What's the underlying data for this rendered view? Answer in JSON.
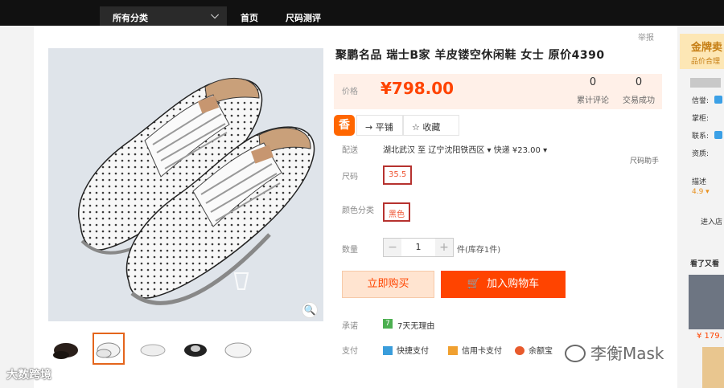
{
  "topnav": {
    "category": "所有分类",
    "links": [
      "首页",
      "尺码测评"
    ]
  },
  "product": {
    "title": "聚鹏名品 瑞士B家 羊皮镂空休闲鞋 女士 原价4390",
    "report": "举报",
    "price_label": "价格",
    "price": "¥798.00",
    "reviews_count": "0",
    "reviews_label": "累计评论",
    "sales_count": "0",
    "sales_label": "交易成功",
    "badge": "香",
    "tab_share": "→ 平铺",
    "tab_fav": "☆ 收藏",
    "shipping_label": "配送",
    "shipping_text": "湖北武汉 至 辽宁沈阳铁西区 ▾  快递 ¥23.00 ▾",
    "size_help": "尺码助手",
    "size_label": "尺码",
    "size_value": "35.5",
    "color_label": "颜色分类",
    "color_value": "黑色",
    "qty_label": "数量",
    "qty_value": "1",
    "qty_minus": "−",
    "qty_plus": "+",
    "stock_text": "件(库存1件)",
    "buy_now": "立即购买",
    "add_cart": "加入购物车",
    "promise_label": "承诺",
    "promise_icon": "7",
    "promise_text": "7天无理由",
    "pay_label": "支付",
    "pay_methods": [
      "快捷支付",
      "信用卡支付",
      "余额宝"
    ],
    "zoom": "🔍"
  },
  "sidebar": {
    "gold_title": "金牌卖",
    "gold_sub": "品价合理",
    "labels": [
      "信誉:",
      "掌柜:",
      "联系:",
      "资质:"
    ],
    "score_label": "描述",
    "score_value": "4.9 ▾",
    "enter_label": "进入店",
    "also_label": "看了又看",
    "also_price": "¥ 179."
  },
  "watermark": {
    "left": "大数跨境",
    "right": "李衡Mask"
  },
  "colors": {
    "accent": "#ff4400",
    "nav": "#111111",
    "gold": "#fde7b5"
  }
}
